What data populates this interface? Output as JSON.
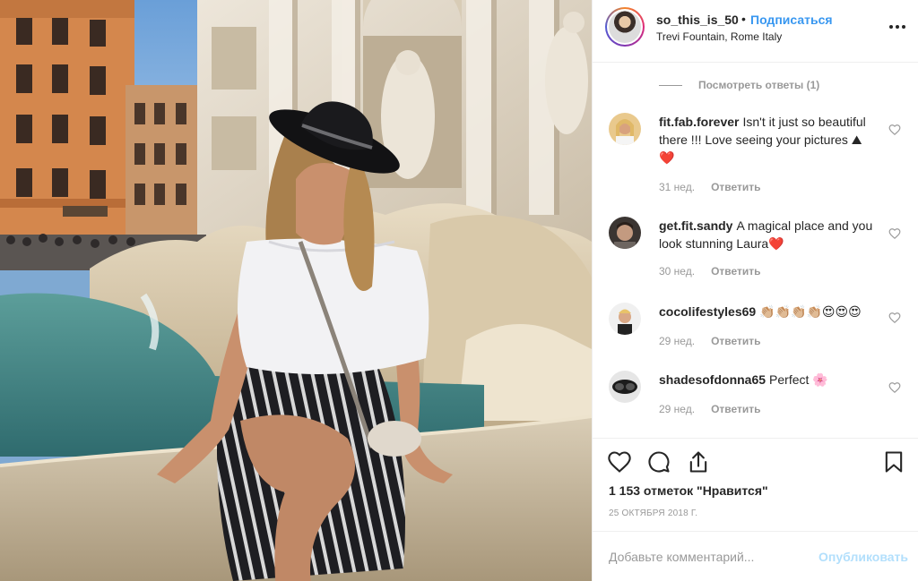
{
  "post": {
    "username": "so_this_is_50",
    "separator": "•",
    "follow_label": "Подписаться",
    "location": "Trevi Fountain, Rome Italy",
    "more_icon": "more-options-icon"
  },
  "view_replies": "Посмотреть ответы (1)",
  "comments": [
    {
      "username": "fit.fab.forever",
      "text": "Isn't it just so beautiful there !!! Love seeing your pictures ⛰❤️",
      "time": "31 нед.",
      "reply": "Ответить"
    },
    {
      "username": "get.fit.sandy",
      "text": "A magical place and you look stunning Laura❤️",
      "time": "30 нед.",
      "reply": "Ответить"
    },
    {
      "username": "cocolifestyles69",
      "text": "👏🏼👏🏼👏🏼👏🏼😍😍😍",
      "time": "29 нед.",
      "reply": "Ответить"
    },
    {
      "username": "shadesofdonna65",
      "text": "Perfect 🌸",
      "time": "29 нед.",
      "reply": "Ответить"
    }
  ],
  "likes": "1 153 отметок \"Нравится\"",
  "date": "25 ОКТЯБРЯ 2018 Г.",
  "add_comment": {
    "placeholder": "Добавьте комментарий...",
    "publish_label": "Опубликовать"
  },
  "colors": {
    "accent": "#3897f0",
    "publish_disabled": "#b2dffc",
    "muted": "#999999",
    "text": "#262626",
    "heart": "#e0245e"
  }
}
